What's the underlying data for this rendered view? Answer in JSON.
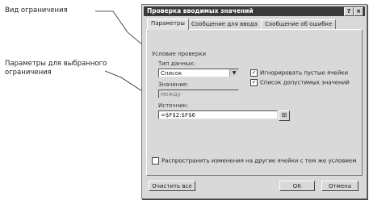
{
  "callouts": {
    "validation_type": "Вид ограничения",
    "parameters": "Параметры для выбранного ограничения"
  },
  "dialog": {
    "title": "Проверка вводимых значений",
    "help_button": "?",
    "close_button": "×",
    "tabs": [
      "Параметры",
      "Сообщение для ввода",
      "Сообщение об ошибке"
    ],
    "criteria_label": "Условие проверки",
    "type_label": "Тип данных:",
    "type_value": "Список",
    "value_label": "Значение:",
    "value_value": "между",
    "source_label": "Источник:",
    "source_value": "=$F$2:$F$6",
    "ignore_blank_label": "Игнорировать пустые ячейки",
    "in_cell_dropdown_label": "Список допустимых значений",
    "apply_all_label": "Распространить изменения на другие ячейки с тем же условием",
    "clear_all_button": "Очистить все",
    "ok_button": "ОК",
    "cancel_button": "Отмена",
    "ignore_blank_checked": "✓",
    "in_cell_dropdown_checked": "✓",
    "apply_all_checked": ""
  }
}
